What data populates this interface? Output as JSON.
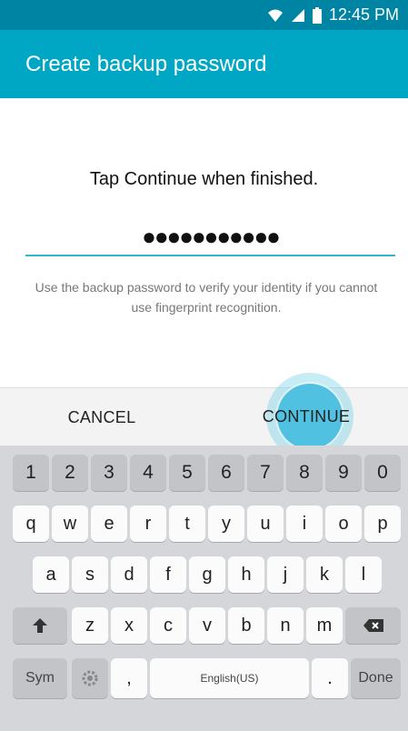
{
  "status_bar": {
    "time": "12:45 PM",
    "icons": [
      "wifi-icon",
      "signal-icon",
      "battery-icon"
    ]
  },
  "app_bar": {
    "title": "Create backup password"
  },
  "form": {
    "instruction": "Tap Continue when finished.",
    "password_masked": "●●●●●●●●●●●",
    "help_text": "Use the backup password to verify your identity if you cannot use fingerprint recognition."
  },
  "buttons": {
    "cancel": "CANCEL",
    "continue": "CONTINUE"
  },
  "keyboard": {
    "number_row": [
      "1",
      "2",
      "3",
      "4",
      "5",
      "6",
      "7",
      "8",
      "9",
      "0"
    ],
    "row1": [
      "q",
      "w",
      "e",
      "r",
      "t",
      "y",
      "u",
      "i",
      "o",
      "p"
    ],
    "row2": [
      "a",
      "s",
      "d",
      "f",
      "g",
      "h",
      "j",
      "k",
      "l"
    ],
    "row3": [
      "z",
      "x",
      "c",
      "v",
      "b",
      "n",
      "m"
    ],
    "sym": "Sym",
    "comma": ",",
    "space_label": "English(US)",
    "period": ".",
    "done": "Done"
  },
  "colors": {
    "status_bar": "#0084a3",
    "app_bar": "#00a7c4",
    "accent_line": "#34b6cf"
  }
}
